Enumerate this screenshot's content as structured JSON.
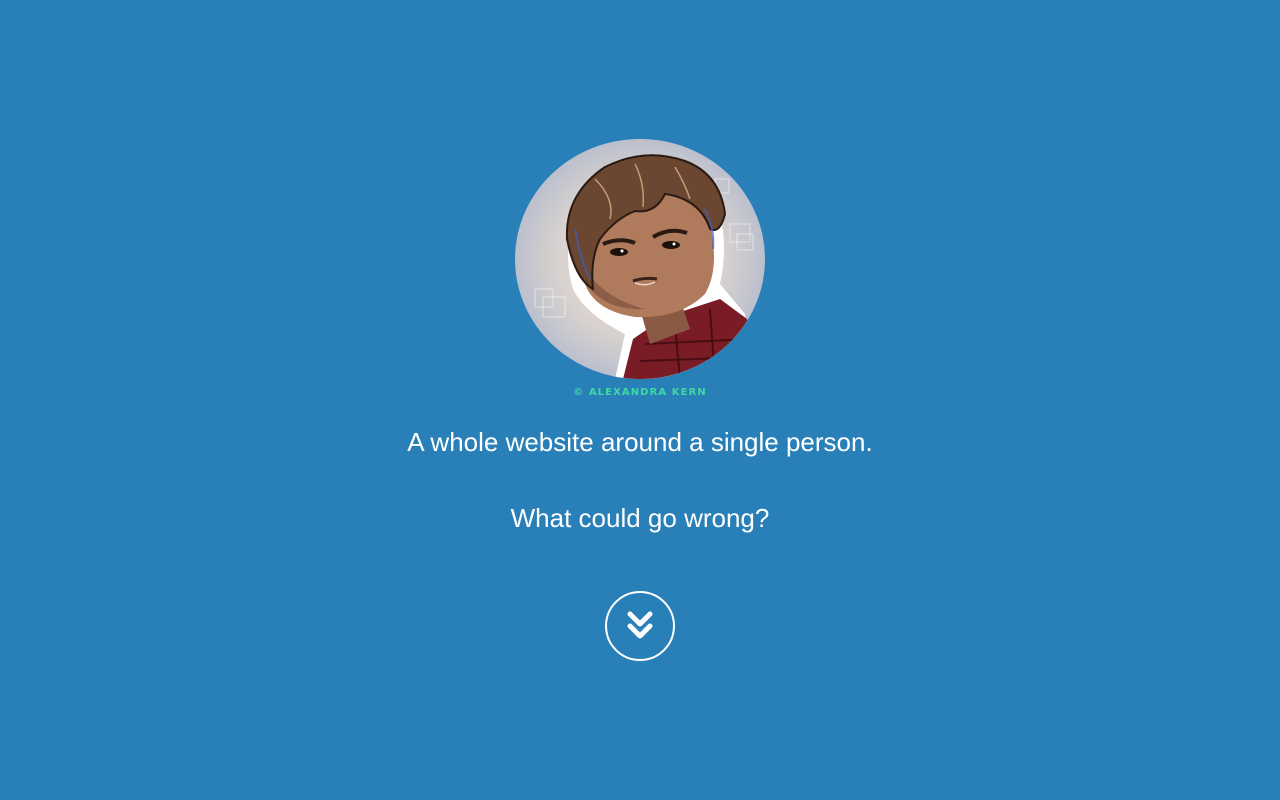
{
  "hero": {
    "avatar_credit": "© ALEXANDRA KERN",
    "tagline_line1": "A whole website around a single person.",
    "tagline_line2": "What could go wrong?"
  },
  "scroll_button": {
    "icon": "double-chevron-down-icon"
  },
  "colors": {
    "background": "#2980b9",
    "text": "#ffffff",
    "credit": "#3fd9a0"
  }
}
